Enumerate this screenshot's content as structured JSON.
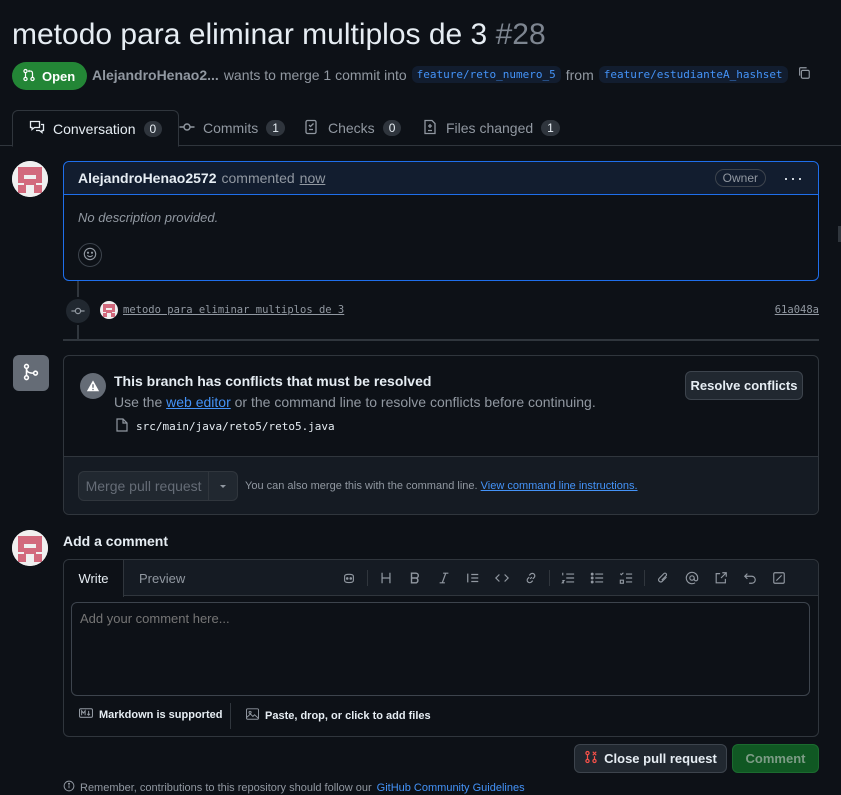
{
  "pr": {
    "title": "metodo para eliminar multiplos de 3",
    "number": "#28",
    "state": "Open",
    "author_short": "AlejandroHenao2...",
    "merge_text": "wants to merge 1 commit into",
    "base_branch": "feature/reto_numero_5",
    "from_text": "from",
    "head_branch": "feature/estudianteA_hashset"
  },
  "tabs": [
    {
      "label": "Conversation",
      "count": "0"
    },
    {
      "label": "Commits",
      "count": "1"
    },
    {
      "label": "Checks",
      "count": "0"
    },
    {
      "label": "Files changed",
      "count": "1"
    }
  ],
  "comment": {
    "author": "AlejandroHenao2572",
    "action": "commented",
    "time": "now",
    "badge": "Owner",
    "body": "No description provided."
  },
  "commit": {
    "message": "metodo para eliminar multiplos de 3",
    "sha": "61a048a"
  },
  "merge": {
    "conflict_title": "This branch has conflicts that must be resolved",
    "conflict_pre": "Use the",
    "conflict_link": "web editor",
    "conflict_post": "or the command line to resolve conflicts before continuing.",
    "conflict_file": "src/main/java/reto5/reto5.java",
    "resolve_label": "Resolve conflicts",
    "merge_label": "Merge pull request",
    "cli_text": "You can also merge this with the command line.",
    "cli_link": "View command line instructions."
  },
  "add_comment": {
    "heading": "Add a comment",
    "tab_write": "Write",
    "tab_preview": "Preview",
    "placeholder": "Add your comment here...",
    "markdown_note": "Markdown is supported",
    "attach_note": "Paste, drop, or click to add files",
    "close_label": "Close pull request",
    "comment_label": "Comment"
  },
  "footer": {
    "pre": "Remember, contributions to this repository should follow our",
    "link": "GitHub Community Guidelines"
  },
  "colors": {
    "accent": "#1f6feb",
    "open_green": "#238636",
    "link": "#4493f8",
    "close_red": "#f85149"
  }
}
